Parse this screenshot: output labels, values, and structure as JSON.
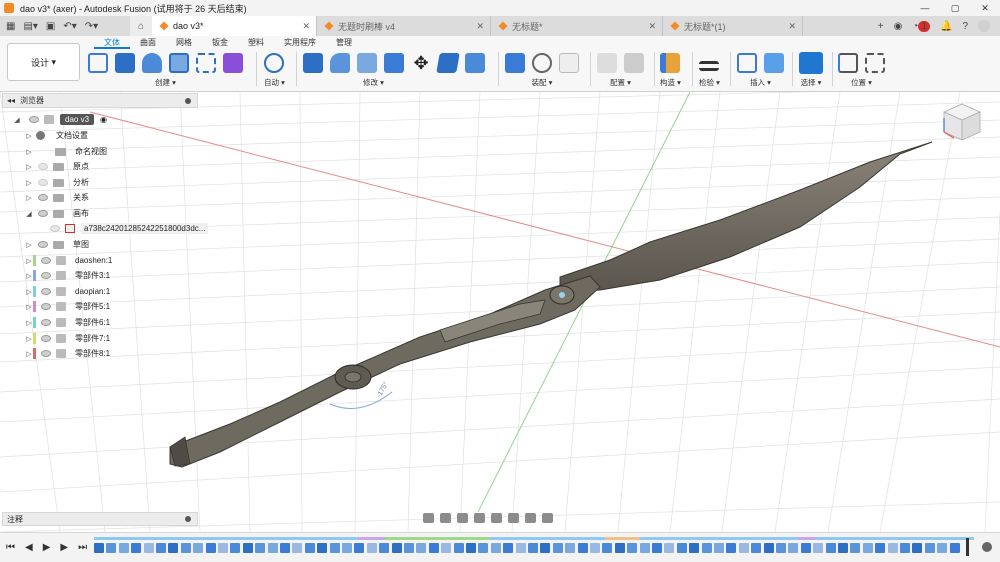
{
  "window": {
    "title": "dao v3* (axer) - Autodesk Fusion (试用将于 26 天后结束)",
    "controls": [
      "—",
      "▢",
      "✕"
    ]
  },
  "tabs": [
    {
      "label": "dao v3*",
      "active": true
    },
    {
      "label": "无题时刷棒 v4",
      "active": false
    },
    {
      "label": "无标题*",
      "active": false
    },
    {
      "label": "无标题*(1)",
      "active": false
    }
  ],
  "tab_right": {
    "notification_count": "1"
  },
  "toolbar": {
    "workspace": "设计",
    "ribbon_tabs": [
      "文体",
      "曲面",
      "网格",
      "钣金",
      "塑料",
      "实用程序",
      "管理"
    ],
    "active_ribbon": "文体",
    "groups": {
      "create": "创建",
      "auto": "自动",
      "modify": "修改",
      "assemble": "装配",
      "configure": "配置",
      "construct": "构造",
      "inspect": "检验",
      "insert": "插入",
      "select": "选择",
      "position": "位置"
    }
  },
  "browser": {
    "title": "浏览器",
    "root": "dao v3",
    "items": [
      {
        "label": "文档设置",
        "type": "settings"
      },
      {
        "label": "命名视图",
        "type": "folder"
      },
      {
        "label": "原点",
        "type": "folder"
      },
      {
        "label": "分析",
        "type": "folder"
      },
      {
        "label": "关系",
        "type": "folder"
      },
      {
        "label": "画布",
        "type": "folder"
      },
      {
        "label": "a738c24201285242251800d3dc...",
        "type": "canvas"
      },
      {
        "label": "草图",
        "type": "folder"
      },
      {
        "label": "daoshen:1",
        "type": "component"
      },
      {
        "label": "零部件3:1",
        "type": "component"
      },
      {
        "label": "daopian:1",
        "type": "component"
      },
      {
        "label": "零部件5:1",
        "type": "component"
      },
      {
        "label": "零部件6:1",
        "type": "component"
      },
      {
        "label": "零部件7:1",
        "type": "component"
      },
      {
        "label": "零部件8:1",
        "type": "component"
      }
    ]
  },
  "comments": {
    "label": "注释"
  },
  "viewport": {
    "dimension_label": "-175°"
  },
  "colors": {
    "accent": "#0a7ad6",
    "app_orange": "#f28c28",
    "model_gray": "#6f6a60",
    "grid": "#dcdcdc",
    "x_axis": "#e06a6a",
    "y_axis": "#7ecb7e"
  }
}
